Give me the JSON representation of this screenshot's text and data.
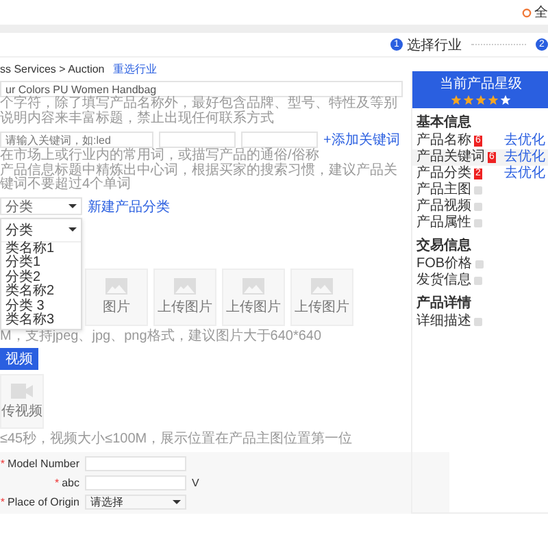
{
  "header": {
    "user_label": "全"
  },
  "steps": [
    {
      "number": "1",
      "label": "选择行业"
    },
    {
      "number": "2"
    }
  ],
  "breadcrumb": {
    "path": "ss Services > Auction",
    "link": "重选行业"
  },
  "product_name": {
    "value": "ur Colors PU Women Handbag",
    "hint": "个字符，除了填写产品名称外，最好包含品牌、型号、特性及等别说明内容来丰富标题，禁止出现任何联系方式"
  },
  "keywords": {
    "fields": [
      {
        "kind": "hinted",
        "placeholder": "请输入关键词，如:led"
      },
      {
        "kind": "blank"
      },
      {
        "kind": "blank"
      }
    ],
    "add_link": "+添加关键词",
    "hints": [
      "在市场上或行业内的常用词，或描写产品的通俗/俗称",
      "产品信息标题中精炼出中心词，根据买家的搜索习惯，建议产品关键词不要超过4个单词"
    ]
  },
  "category": {
    "value": "分类",
    "link": "新建产品分类",
    "dropdown": {
      "value": "分类",
      "options": [
        "类名称1",
        "分类1",
        "分类2",
        "类名称2",
        "分类 3",
        "类名称3"
      ]
    }
  },
  "images": {
    "slots": [
      {
        "label": "图片"
      },
      {
        "label": "上传图片"
      },
      {
        "label": "上传图片"
      },
      {
        "label": "上传图片"
      }
    ],
    "hint": "M，支持jpeg、jpg、png格式，建议图片大于640*640"
  },
  "video": {
    "button": "视频",
    "upload_label": "传视频",
    "hint": "≤45秒，视频大小≤100M，展示位置在产品主图位置第一位"
  },
  "attributes": [
    {
      "mark": "*",
      "label": "Model Number",
      "kind": "text"
    },
    {
      "mark": "*",
      "label": "abc",
      "kind": "text",
      "unit": "V"
    },
    {
      "mark": "*",
      "label": "Place of Origin",
      "kind": "select",
      "value": "请选择"
    }
  ],
  "score_panel": {
    "title": "当前产品星级",
    "stars": 4,
    "sections": [
      {
        "title": "基本信息",
        "items": [
          {
            "label": "产品名称",
            "kind": "issue",
            "count": "6",
            "action": "去优化",
            "selected": false
          },
          {
            "label": "产品关键词",
            "kind": "issue",
            "count": "6",
            "action": "去优化",
            "selected": true
          },
          {
            "label": "产品分类",
            "kind": "issue",
            "count": "2",
            "action": "去优化",
            "selected": false
          },
          {
            "label": "产品主图",
            "kind": "pending",
            "selected": false
          },
          {
            "label": "产品视频",
            "kind": "pending",
            "selected": false
          },
          {
            "label": "产品属性",
            "kind": "pending",
            "selected": false
          }
        ]
      },
      {
        "title": "交易信息",
        "items": [
          {
            "label": "FOB价格",
            "kind": "pending",
            "selected": false
          },
          {
            "label": "发货信息",
            "kind": "pending",
            "selected": false
          }
        ]
      },
      {
        "title": "产品详情",
        "items": [
          {
            "label": "详细描述",
            "kind": "pending",
            "selected": false
          }
        ]
      }
    ]
  }
}
